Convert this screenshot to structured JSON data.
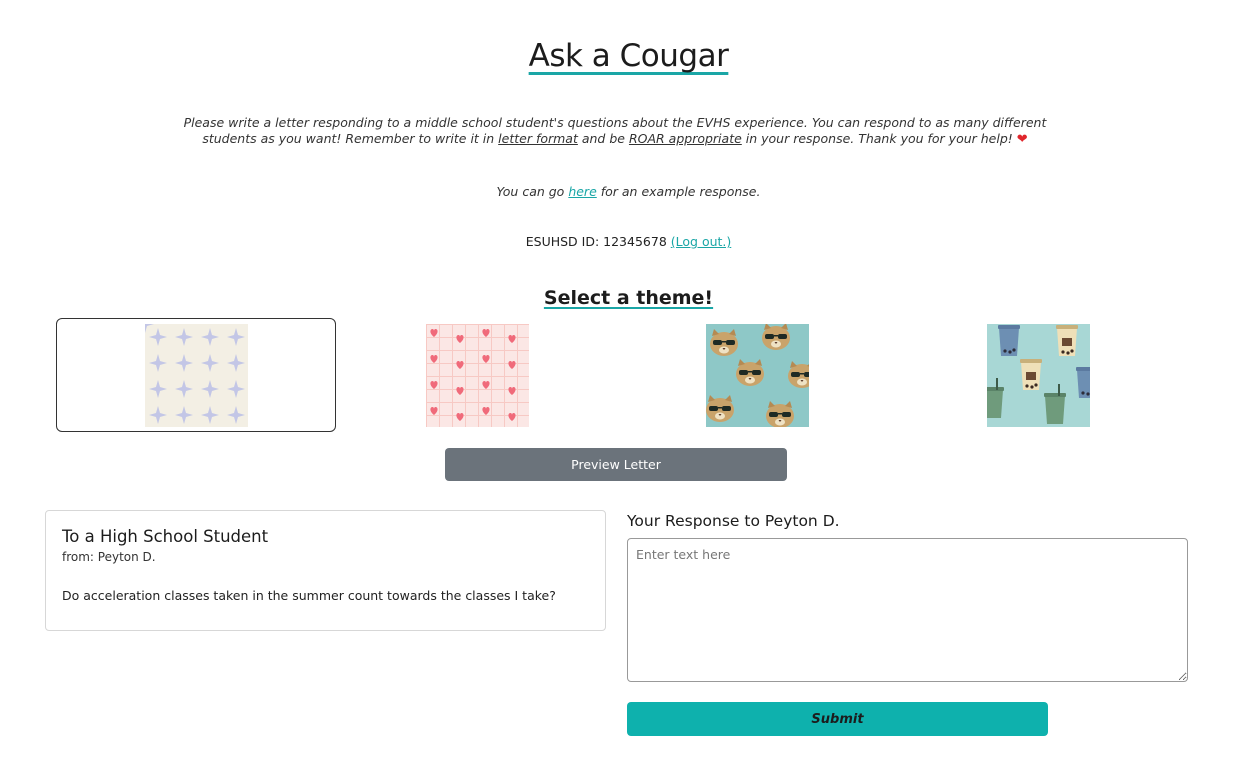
{
  "page": {
    "title": "Ask a Cougar",
    "intro": {
      "part1": "Please write a letter responding to a middle school student's questions about the EVHS experience. You can respond to as many different students as you want! Remember to write it in ",
      "link_letter_format": "letter format",
      "part2": " and be ",
      "link_roar": "ROAR appropriate",
      "part3": " in your response. Thank you for your help!",
      "heart": "❤"
    },
    "example": {
      "prefix": "You can go ",
      "link": "here",
      "suffix": " for an example response."
    },
    "id_line": {
      "label": "ESUHSD ID: 12345678",
      "logout": "(Log out.)"
    }
  },
  "themes": {
    "heading": "Select a theme!",
    "selected": "sparkle",
    "options": [
      {
        "id": "sparkle",
        "colors": {
          "bg": "#f3efe4",
          "accent": "#c3c6e6"
        }
      },
      {
        "id": "hearts",
        "colors": {
          "bg": "#fbe7e5",
          "accent": "#f06a7a"
        }
      },
      {
        "id": "cougar",
        "colors": {
          "bg": "#8ec8c7",
          "accent": "#c9a36a"
        }
      },
      {
        "id": "boba",
        "colors": {
          "bg": "#a8d7d5",
          "accent": "#6f9b7c"
        }
      }
    ]
  },
  "actions": {
    "preview_label": "Preview Letter",
    "submit_label": "Submit"
  },
  "letter": {
    "title": "To a High School Student",
    "from": "from: Peyton D.",
    "question": "Do acceleration classes taken in the summer count towards the classes I take?"
  },
  "response": {
    "label": "Your Response to Peyton D.",
    "placeholder": "Enter text here",
    "value": ""
  },
  "colors": {
    "accent": "#1aa6a6",
    "submit_bg": "#0eb1ad",
    "preview_bg": "#6b737b",
    "heart": "#e0262c"
  }
}
